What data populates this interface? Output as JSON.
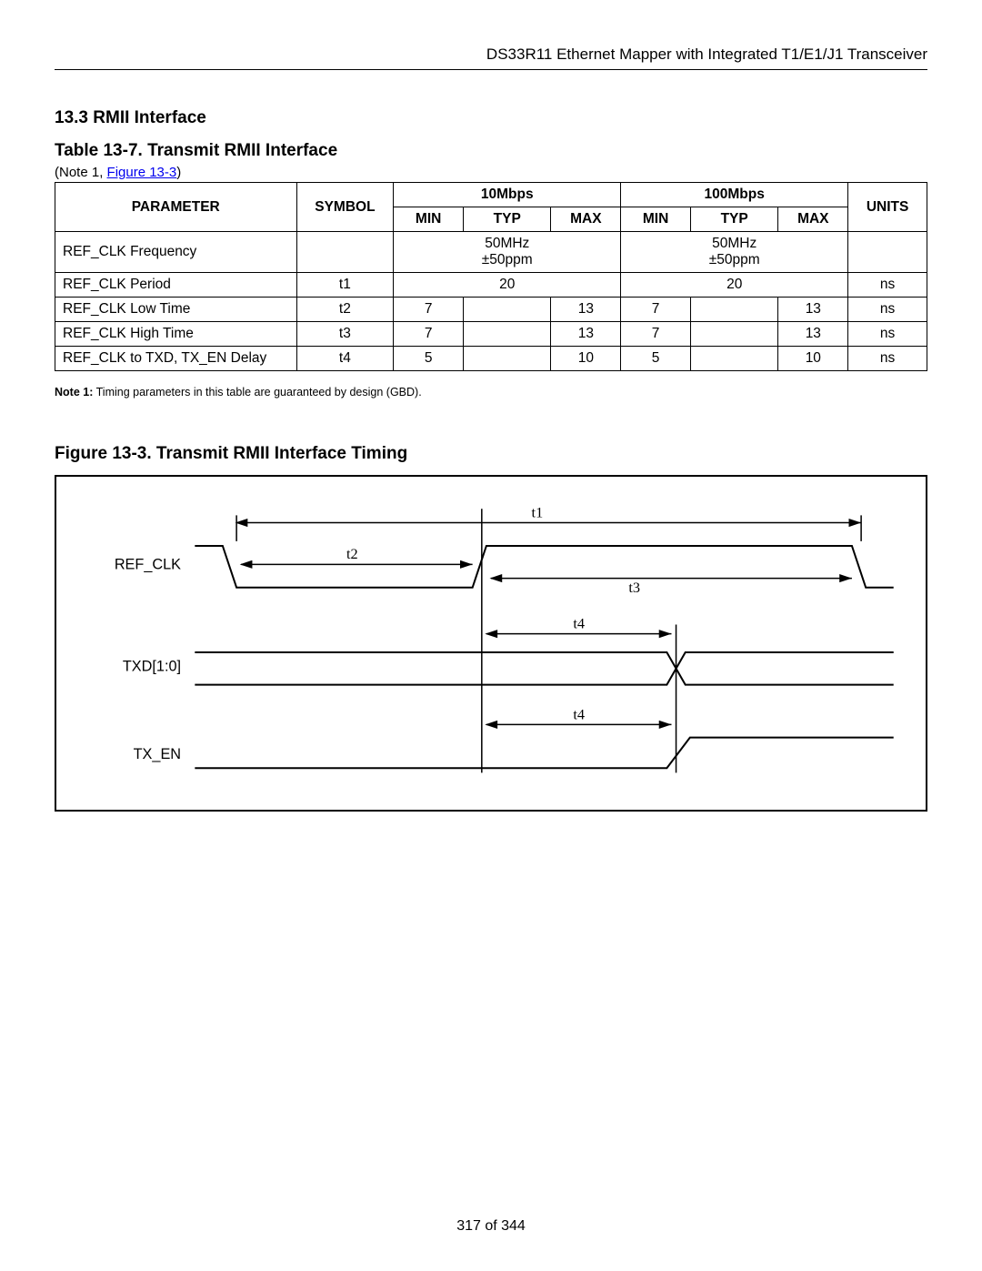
{
  "header": {
    "right": "DS33R11 Ethernet Mapper with Integrated T1/E1/J1 Transceiver"
  },
  "section": {
    "number": "13.3",
    "title": "RMII Interface"
  },
  "table": {
    "title": "Table 13-7. Transmit RMII Interface",
    "note_prefix": "(Note 1, ",
    "note_link": "Figure 13-3",
    "note_suffix": ")",
    "headers": {
      "parameter": "PARAMETER",
      "symbol": "SYMBOL",
      "group10": "10Mbps",
      "group100": "100Mbps",
      "min": "MIN",
      "typ": "TYP",
      "max": "MAX",
      "units": "UNITS"
    },
    "rows": [
      {
        "param": "REF_CLK Frequency",
        "sym": "",
        "typ10_a": "50MHz",
        "typ10_b": "±50ppm",
        "typ100_a": "50MHz",
        "typ100_b": "±50ppm",
        "units": ""
      },
      {
        "param": "REF_CLK Period",
        "sym": "t1",
        "typ10": "20",
        "typ100": "20",
        "units": "ns"
      },
      {
        "param": "REF_CLK Low Time",
        "sym": "t2",
        "min10": "7",
        "max10": "13",
        "min100": "7",
        "max100": "13",
        "units": "ns"
      },
      {
        "param": "REF_CLK High Time",
        "sym": "t3",
        "min10": "7",
        "max10": "13",
        "min100": "7",
        "max100": "13",
        "units": "ns"
      },
      {
        "param": "REF_CLK to TXD, TX_EN Delay",
        "sym": "t4",
        "min10": "5",
        "max10": "10",
        "min100": "5",
        "max100": "10",
        "units": "ns"
      }
    ],
    "note1": "Note 1: Timing parameters in this table are guaranteed by design (GBD)."
  },
  "figure": {
    "title": "Figure 13-3. Transmit RMII Interface Timing",
    "labels": {
      "refclk": "REF_CLK",
      "txd": "TXD[1:0]",
      "txen": "TX_EN",
      "t1": "t1",
      "t2": "t2",
      "t3": "t3",
      "t4": "t4"
    }
  },
  "footer": {
    "page": "317 of 344"
  }
}
